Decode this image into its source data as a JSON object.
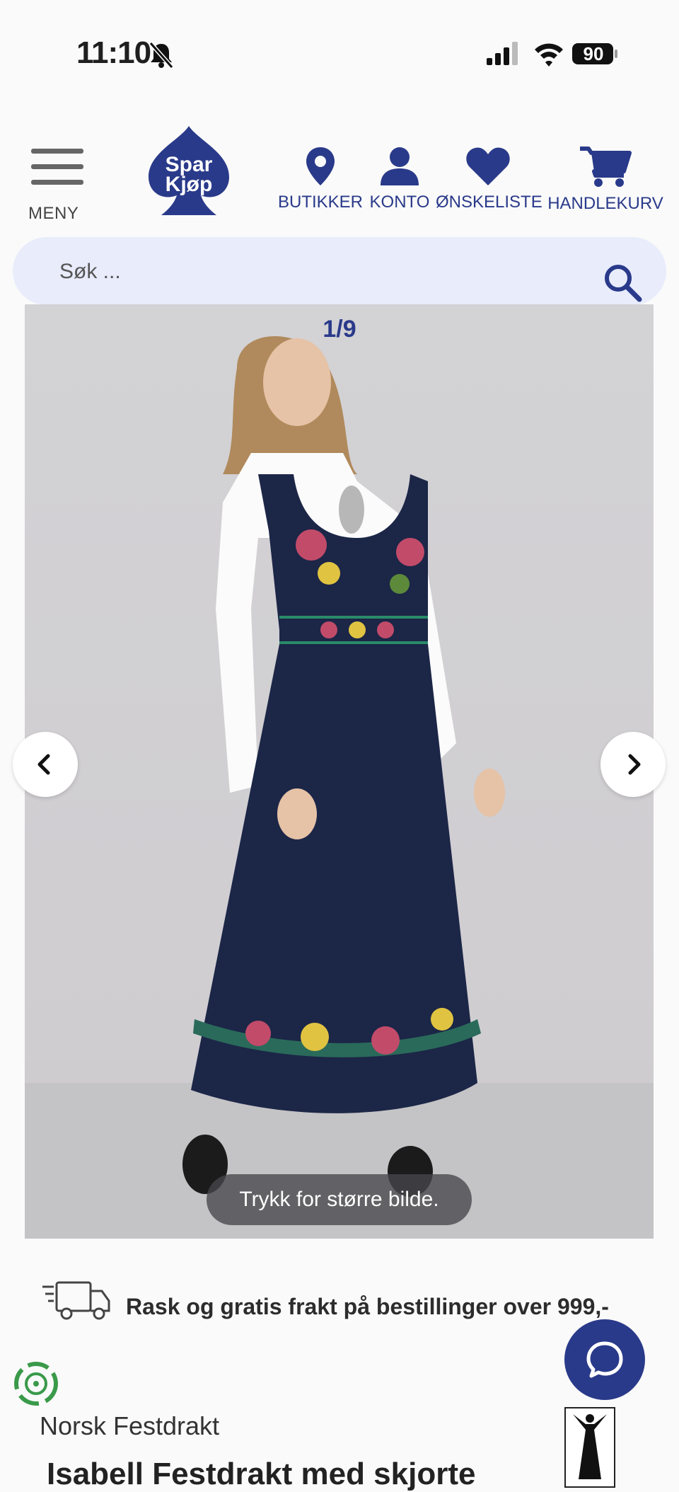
{
  "status_bar": {
    "time": "11:10",
    "battery": "90"
  },
  "header": {
    "menu_label": "MENY",
    "logo_text": [
      "Spar",
      "Kjøp"
    ],
    "nav": [
      {
        "label": "BUTIKKER",
        "icon": "location-pin-icon"
      },
      {
        "label": "KONTO",
        "icon": "user-icon"
      },
      {
        "label": "ØNSKELISTE",
        "icon": "heart-icon"
      },
      {
        "label": "HANDLEKURV",
        "icon": "cart-icon"
      }
    ]
  },
  "search": {
    "placeholder": "Søk ..."
  },
  "gallery": {
    "counter": "1/9",
    "zoom_hint": "Trykk for større bilde."
  },
  "shipping": {
    "text": "Rask og gratis frakt på bestillinger over 999,-"
  },
  "product": {
    "brand": "Norsk Festdrakt",
    "title": "Isabell Festdrakt med skjorte"
  },
  "colors": {
    "brand_blue": "#2a3a8a",
    "search_bg": "#e8ecfb"
  }
}
